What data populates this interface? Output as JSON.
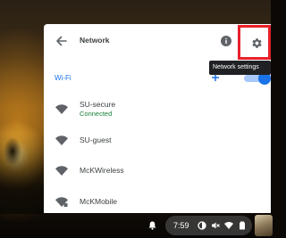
{
  "header": {
    "title": "Network",
    "back_icon": "arrow-left-icon",
    "info_icon": "info-icon",
    "settings_icon": "gear-icon"
  },
  "tooltip": {
    "text": "Network settings"
  },
  "wifi_section": {
    "label": "Wi-Fi",
    "add_icon": "plus-icon",
    "toggle_on": true
  },
  "networks": [
    {
      "name": "SU-secure",
      "status": "Connected"
    },
    {
      "name": "SU-guest",
      "status": ""
    },
    {
      "name": "McKWireless",
      "status": ""
    },
    {
      "name": "McKMobile",
      "status": ""
    }
  ],
  "shelf": {
    "time": "7:59",
    "icons": [
      "bell-icon",
      "screen-capture-icon",
      "mute-icon",
      "wifi-icon",
      "battery-icon"
    ]
  },
  "colors": {
    "accent": "#1a73e8",
    "connected": "#188038",
    "highlight": "#e8202a",
    "tooltip_bg": "#202124"
  }
}
